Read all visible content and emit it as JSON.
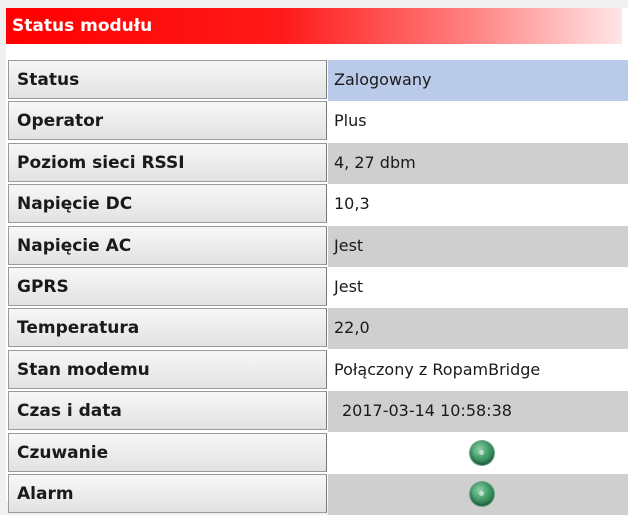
{
  "panel": {
    "title": "Status modułu"
  },
  "rows": [
    {
      "label": "Status",
      "value": "Zalogowany",
      "style": "blue"
    },
    {
      "label": "Operator",
      "value": "Plus",
      "style": "white"
    },
    {
      "label": "Poziom sieci RSSI",
      "value": "4, 27 dbm",
      "style": "gray"
    },
    {
      "label": "Napięcie DC",
      "value": "10,3",
      "style": "white"
    },
    {
      "label": "Napięcie AC",
      "value": "Jest",
      "style": "gray"
    },
    {
      "label": "GPRS",
      "value": "Jest",
      "style": "white"
    },
    {
      "label": "Temperatura",
      "value": "22,0",
      "style": "gray"
    },
    {
      "label": "Stan modemu",
      "value": "Połączony z RopamBridge",
      "style": "white"
    },
    {
      "label": "Czas i data",
      "value": "2017-03-14 10:58:38",
      "style": "gray"
    },
    {
      "label": "Czuwanie",
      "indicator": "green-led-icon",
      "style": "white"
    },
    {
      "label": "Alarm",
      "indicator": "green-led-icon",
      "style": "gray"
    }
  ],
  "colors": {
    "title_bar": "#ff0000",
    "status_highlight": "#b9cbe8",
    "alt_row": "#cfcfcf",
    "indicator_green": "#3f9a67"
  }
}
